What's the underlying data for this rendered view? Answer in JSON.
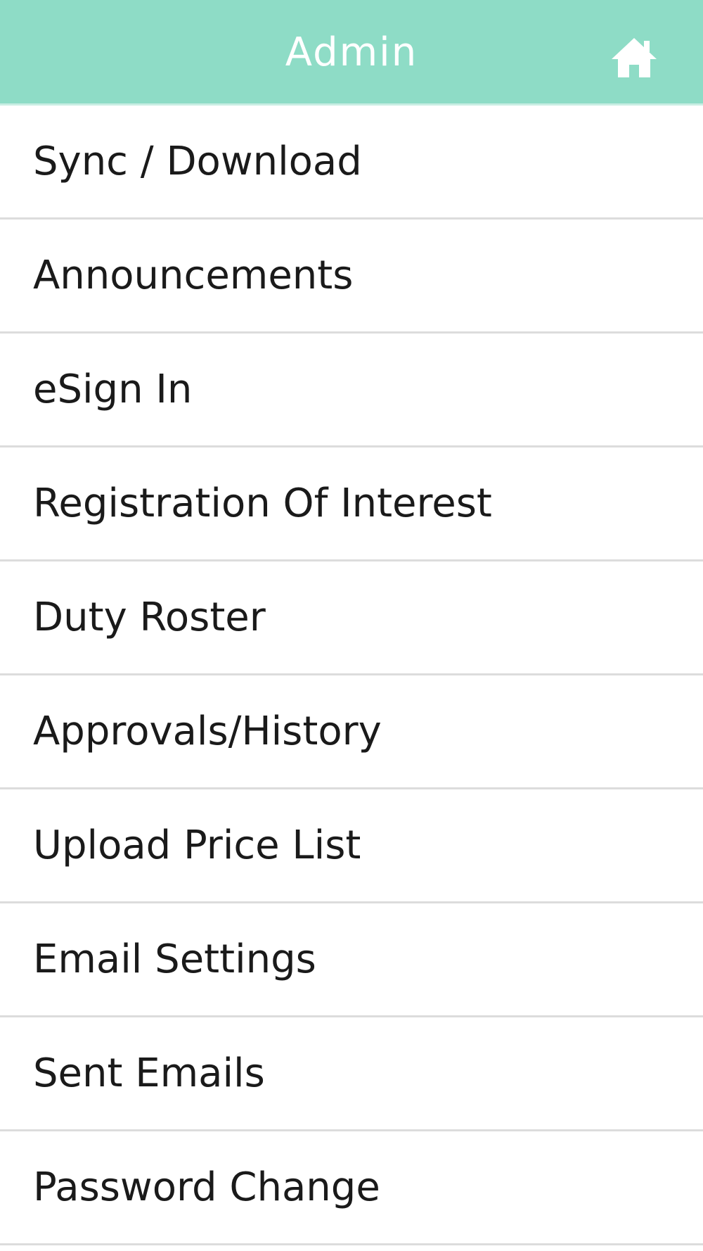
{
  "header": {
    "title": "Admin",
    "home_icon": "home-icon"
  },
  "colors": {
    "header_background": "#8edcc6",
    "header_text": "#ffffff",
    "divider": "#dcdcdc"
  },
  "menu": {
    "items": [
      {
        "label": "Sync / Download"
      },
      {
        "label": "Announcements"
      },
      {
        "label": "eSign In"
      },
      {
        "label": "Registration Of Interest"
      },
      {
        "label": "Duty Roster"
      },
      {
        "label": "Approvals/History"
      },
      {
        "label": "Upload Price List"
      },
      {
        "label": "Email Settings"
      },
      {
        "label": "Sent Emails"
      },
      {
        "label": "Password Change"
      }
    ]
  }
}
